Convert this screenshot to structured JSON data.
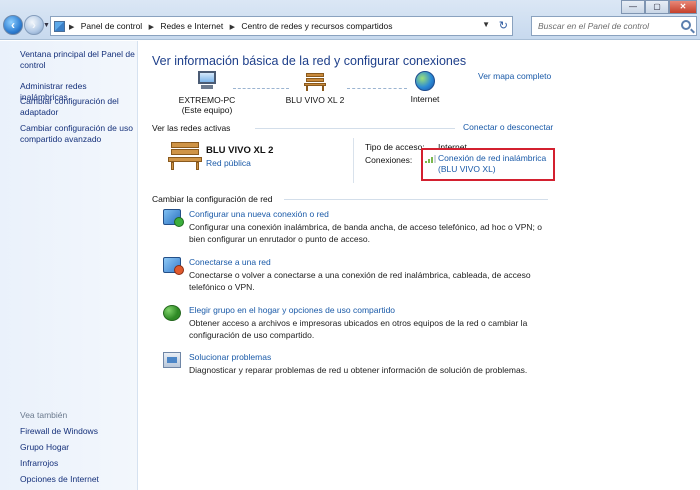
{
  "window": {
    "controls": {
      "minimize": "—",
      "maximize": "▢",
      "close": "✕"
    }
  },
  "nav": {
    "back_icon": "arrow-left",
    "forward_icon": "arrow-right"
  },
  "address_bar": {
    "crumbs": [
      "Panel de control",
      "Redes e Internet",
      "Centro de redes y recursos compartidos"
    ]
  },
  "search": {
    "placeholder": "Buscar en el Panel de control"
  },
  "sidebar": {
    "items": [
      {
        "label": "Ventana principal del Panel de control"
      },
      {
        "label": "Administrar redes inalámbricas"
      },
      {
        "label": "Cambiar configuración del adaptador"
      },
      {
        "label": "Cambiar configuración de uso compartido avanzado"
      }
    ],
    "see_also_title": "Vea también",
    "see_also": [
      {
        "label": "Firewall de Windows"
      },
      {
        "label": "Grupo Hogar"
      },
      {
        "label": "Infrarrojos"
      },
      {
        "label": "Opciones de Internet"
      }
    ]
  },
  "main": {
    "heading": "Ver información básica de la red y configurar conexiones",
    "view_map_link": "Ver mapa completo",
    "map": {
      "computer_name": "EXTREMO-PC",
      "computer_sub": "(Este equipo)",
      "network_name": "BLU VIVO XL  2",
      "internet_label": "Internet"
    },
    "active_networks": {
      "title": "Ver las redes activas",
      "connect_link": "Conectar o desconectar",
      "network_name": "BLU VIVO XL  2",
      "network_type": "Red pública",
      "access_type_label": "Tipo de acceso:",
      "access_type_value": "Internet",
      "connections_label": "Conexiones:",
      "connection_line1": "Conexión de red inalámbrica",
      "connection_line2": "(BLU VIVO XL)"
    },
    "change_settings": {
      "title": "Cambiar la configuración de red",
      "tasks": [
        {
          "title": "Configurar una nueva conexión o red",
          "desc": "Configurar una conexión inalámbrica, de banda ancha, de acceso telefónico, ad hoc o VPN; o bien configurar un enrutador o punto de acceso."
        },
        {
          "title": "Conectarse a una red",
          "desc": "Conectarse o volver a conectarse a una conexión de red inalámbrica, cableada, de acceso telefónico o VPN."
        },
        {
          "title": "Elegir grupo en el hogar y opciones de uso compartido",
          "desc": "Obtener acceso a archivos e impresoras ubicados en otros equipos de la red o cambiar la configuración de uso compartido."
        },
        {
          "title": "Solucionar problemas",
          "desc": "Diagnosticar y reparar problemas de red u obtener información de solución de problemas."
        }
      ]
    }
  },
  "colors": {
    "link": "#1a5aa8",
    "heading": "#1e3f8a",
    "highlight_box": "#d3202f"
  }
}
